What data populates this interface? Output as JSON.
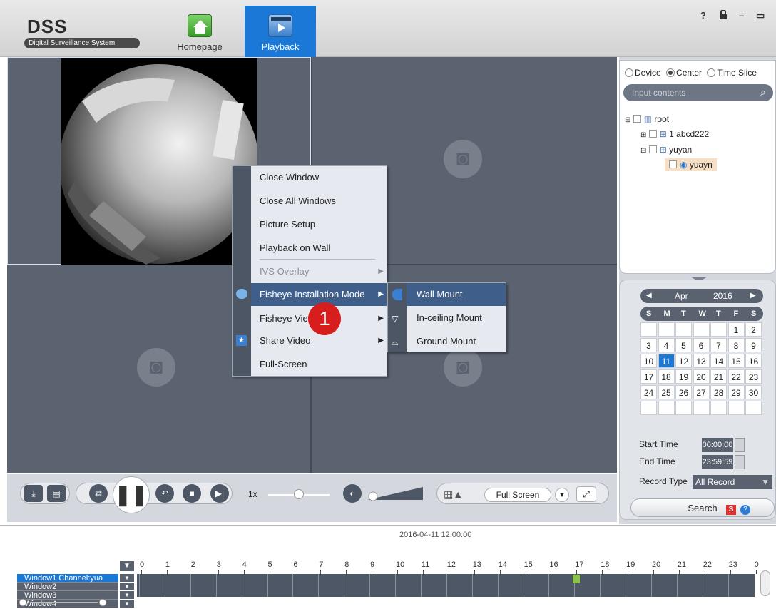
{
  "header": {
    "logo_title": "DSS",
    "logo_subtitle": "Digital Surveillance System",
    "tabs": [
      {
        "label": "Homepage",
        "icon": "home-icon"
      },
      {
        "label": "Playback",
        "icon": "playback-icon"
      }
    ],
    "window_buttons": {
      "help": "?",
      "lock": "⌂",
      "minimize": "–",
      "maximize": "▭"
    }
  },
  "context_menu": {
    "items": [
      {
        "label": "Close Window"
      },
      {
        "label": "Close All Windows"
      },
      {
        "label": "Picture Setup"
      },
      {
        "label": "Playback on Wall"
      },
      {
        "label": "IVS Overlay"
      },
      {
        "label": "Fisheye Installation Mode"
      },
      {
        "label": "Fisheye View"
      },
      {
        "label": "Share Video"
      },
      {
        "label": "Full-Screen"
      }
    ]
  },
  "submenu": {
    "items": [
      {
        "label": "Wall Mount"
      },
      {
        "label": "In-ceiling Mount"
      },
      {
        "label": "Ground Mount"
      }
    ]
  },
  "annotation": {
    "badge": "1"
  },
  "right_panel": {
    "radio": {
      "device": "Device",
      "center": "Center",
      "time_slice": "Time Slice"
    },
    "search_placeholder": "Input contents",
    "tree": [
      {
        "label": "root"
      },
      {
        "label": "1 abcd222"
      },
      {
        "label": "yuyan"
      },
      {
        "label": "yuayn"
      }
    ],
    "calendar": {
      "month": "Apr",
      "year": "2016",
      "days_header": [
        "S",
        "M",
        "T",
        "W",
        "T",
        "F",
        "S"
      ],
      "weeks": [
        [
          "",
          "",
          "",
          "",
          "",
          "1",
          "2"
        ],
        [
          "3",
          "4",
          "5",
          "6",
          "7",
          "8",
          "9"
        ],
        [
          "10",
          "11",
          "12",
          "13",
          "14",
          "15",
          "16"
        ],
        [
          "17",
          "18",
          "19",
          "20",
          "21",
          "22",
          "23"
        ],
        [
          "24",
          "25",
          "26",
          "27",
          "28",
          "29",
          "30"
        ],
        [
          "",
          "",
          "",
          "",
          "",
          "",
          ""
        ]
      ],
      "selected": "11"
    },
    "start_time_label": "Start Time",
    "start_time": "00:00:00",
    "end_time_label": "End Time",
    "end_time": "23:59:59",
    "record_type_label": "Record Type",
    "record_type": "All Record",
    "search_button": "Search"
  },
  "controls": {
    "speed": "1x",
    "full_screen": "Full Screen"
  },
  "timeline": {
    "date": "2016-04-11 12:00:00",
    "hours": [
      "0",
      "1",
      "2",
      "3",
      "4",
      "5",
      "6",
      "7",
      "8",
      "9",
      "10",
      "11",
      "12",
      "13",
      "14",
      "15",
      "16",
      "17",
      "18",
      "19",
      "20",
      "21",
      "22",
      "23",
      "0"
    ],
    "rows": [
      "Window1 Channel:yua",
      "Window2",
      "Window3",
      "Window4"
    ]
  }
}
